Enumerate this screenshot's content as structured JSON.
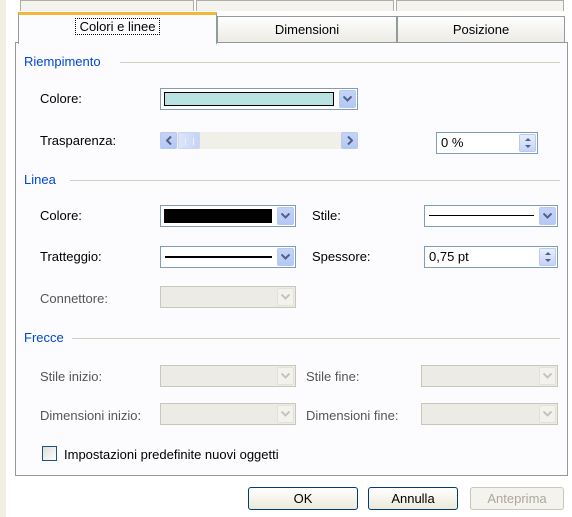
{
  "tabs": [
    {
      "label": "Colori e linee"
    },
    {
      "label": "Dimensioni"
    },
    {
      "label": "Posizione"
    }
  ],
  "fill": {
    "group_title": "Riempimento",
    "color_label": "Colore:",
    "color_value": "#b9e3e3",
    "transparency_label": "Trasparenza:",
    "transparency_value": "0 %",
    "transparency_level": 0
  },
  "line": {
    "group_title": "Linea",
    "color_label": "Colore:",
    "color_value": "#000000",
    "style_label": "Stile:",
    "dash_label": "Tratteggio:",
    "weight_label": "Spessore:",
    "weight_value": "0,75 pt",
    "connector_label": "Connettore:"
  },
  "arrows": {
    "group_title": "Frecce",
    "begin_style_label": "Stile inizio:",
    "end_style_label": "Stile fine:",
    "begin_size_label": "Dimensioni inizio:",
    "end_size_label": "Dimensioni fine:"
  },
  "defaults_checkbox": {
    "label": "Impostazioni predefinite nuovi oggetti",
    "checked": false
  },
  "buttons": {
    "ok": "OK",
    "cancel": "Annulla",
    "preview": "Anteprima"
  }
}
